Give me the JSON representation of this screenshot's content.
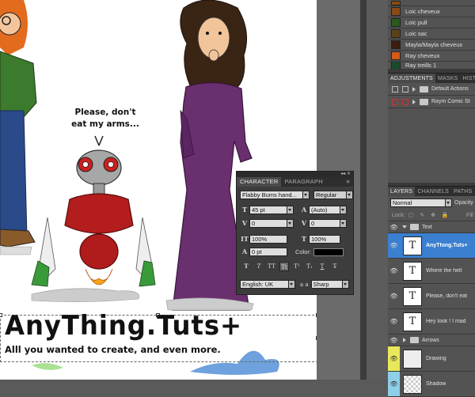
{
  "canvas": {
    "speech_line1": "Please, don't",
    "speech_line2": "eat my arms...",
    "title": "AnyThing.Tuts+",
    "subtitle": "Alll you wanted to create, and even more."
  },
  "character_panel": {
    "tabs": [
      {
        "label": "CHARACTER",
        "active": true
      },
      {
        "label": "PARAGRAPH",
        "active": false
      }
    ],
    "font_family": "Flabby Bums hand...",
    "font_style": "Regular",
    "font_size": "45 pt",
    "leading": "(Auto)",
    "kerning": "0",
    "tracking": "0",
    "vertical_scale": "100%",
    "horizontal_scale": "100%",
    "baseline_shift": "0 pt",
    "color_label": "Color:",
    "color_value": "#000000",
    "language": "English: UK",
    "antialias": "Sharp",
    "aa_label": "a a",
    "type_buttons": [
      "T",
      "T",
      "TT",
      "Tt",
      "T¹",
      "T₁",
      "T",
      "T̶"
    ]
  },
  "swatches": [
    {
      "label": "Loic cheveux",
      "color": "#8a4a14"
    },
    {
      "label": "Loic pull",
      "color": "#2a5a1e"
    },
    {
      "label": "Loic sac",
      "color": "#5a4218"
    },
    {
      "label": "Mayla/Mayla cheveux",
      "color": "#3a1e0e"
    },
    {
      "label": "Ray cheveux",
      "color": "#d45a1a"
    },
    {
      "label": "Ray treills 1",
      "color": "#1a4a2a"
    }
  ],
  "adjustments": {
    "tabs": [
      "ADJUSTMENTS",
      "MASKS",
      "HISTORY"
    ],
    "rows": [
      {
        "label": "Default Actions",
        "checked": false
      },
      {
        "label": "Raym Comic St",
        "checked": true
      }
    ]
  },
  "layers": {
    "tabs": [
      "LAYERS",
      "CHANNELS",
      "PATHS"
    ],
    "blend_mode": "Normal",
    "opacity_label": "Opacity",
    "lock_label": "Lock:",
    "fill_label": "Fill",
    "group_text": "Text",
    "text_layers": [
      {
        "label": "AnyThing.Tuts+",
        "selected": true
      },
      {
        "label": "Where the hell",
        "selected": false
      },
      {
        "label": "Please, don't eat",
        "selected": false
      },
      {
        "label": "Hey look ! I mad",
        "selected": false
      }
    ],
    "group_arrows": "Arrows",
    "drawing_layer": "Drawing",
    "shadow_layer": "Shadow"
  }
}
